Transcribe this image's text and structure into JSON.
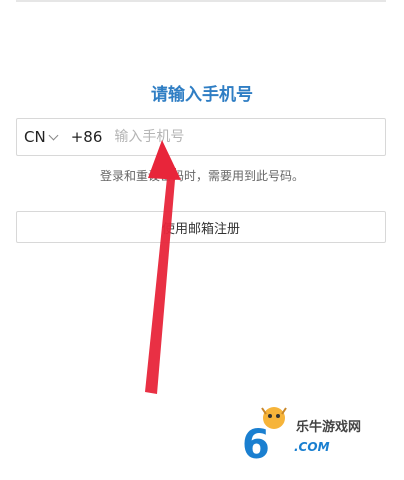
{
  "title": "请输入手机号",
  "phone": {
    "country_code": "CN",
    "dial_code": "+86",
    "placeholder": "输入手机号",
    "value": ""
  },
  "hint": "登录和重设密码时，需要用到此号码。",
  "email_button_label": "使用邮箱注册",
  "watermark": {
    "name": "乐牛游戏网",
    "url": ".COM"
  },
  "colors": {
    "title": "#2f7ec4",
    "arrow": "#e8253a",
    "border": "#d8d8d8"
  }
}
